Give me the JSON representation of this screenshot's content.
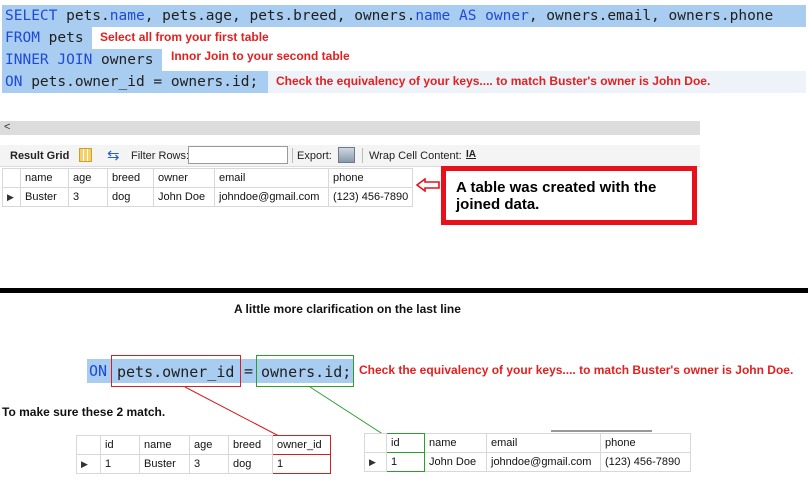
{
  "sql": {
    "line1": {
      "select_kw": "SELECT",
      "t1": " pets.",
      "name_kw": "name",
      "t2": ", pets.age, pets.breed, owners.",
      "name_kw2": "name",
      "as_kw": " AS ",
      "owner_kw": "owner",
      "t3": ", owners.email, owners.phone"
    },
    "line2": {
      "from_kw": "FROM",
      "t1": " pets"
    },
    "line3": {
      "join_kw": "INNER JOIN",
      "t1": " owners"
    },
    "line4": {
      "on_kw": "ON",
      "t1": " pets.owner_id = owners.id;"
    }
  },
  "notes": {
    "select_note": "Select all from your first table",
    "join_note": "Innor Join to your second table",
    "on_note": "Check the equivalency of your keys.... to match Buster's  owner is John Doe."
  },
  "toolbar": {
    "result_grid": "Result Grid",
    "filter_rows": "Filter Rows:",
    "export": "Export:",
    "wrap_cell": "Wrap Cell Content:",
    "wrap_icon_glyph": "IA"
  },
  "result_table": {
    "headers": [
      "name",
      "age",
      "breed",
      "owner",
      "email",
      "phone"
    ],
    "row": [
      "Buster",
      "3",
      "dog",
      "John Doe",
      "johndoe@gmail.com",
      "(123) 456-7890"
    ]
  },
  "callout": "A table was created with the joined data.",
  "clarification": {
    "heading": "A little more clarification on the last line",
    "on_kw": "ON",
    "left_key": "pets.owner_id",
    "eq": "=",
    "right_key": "owners.id;",
    "note": "Check the equivalency of your keys.... to match Buster's  owner is John Doe.",
    "match_note": "To make sure these 2 match."
  },
  "pets_table": {
    "headers": [
      "id",
      "name",
      "age",
      "breed",
      "owner_id"
    ],
    "row": [
      "1",
      "Buster",
      "3",
      "dog",
      "1"
    ]
  },
  "owners_table": {
    "headers": [
      "id",
      "name",
      "email",
      "phone"
    ],
    "row": [
      "1",
      "John Doe",
      "johndoe@gmail.com",
      "(123) 456-7890"
    ]
  },
  "colors": {
    "keyword": "#1f49d6",
    "selection": "#a9cdf0",
    "note_red": "#e22020",
    "callout_border": "#e8101a",
    "green_box": "#2aa02a"
  }
}
